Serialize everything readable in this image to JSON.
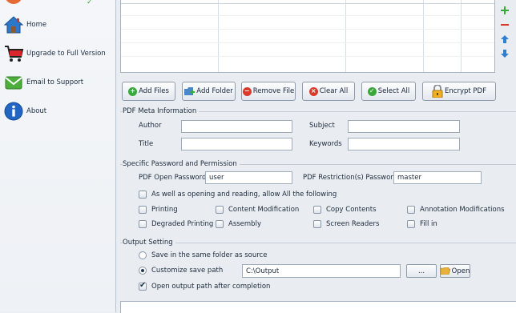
{
  "sidebar": {
    "items": [
      {
        "label": "Home",
        "icon": "home-icon"
      },
      {
        "label": "Upgrade to Full Version",
        "icon": "cart-icon"
      },
      {
        "label": "Email to Support",
        "icon": "email-icon"
      },
      {
        "label": "About",
        "icon": "info-icon"
      }
    ]
  },
  "toolbar": {
    "add_files": "Add Files",
    "add_folder": "Add Folder",
    "remove_file": "Remove File",
    "clear_all": "Clear All",
    "select_all": "Select All",
    "encrypt_pdf": "Encrypt PDF"
  },
  "meta": {
    "legend": "PDF Meta Information",
    "author_label": "Author",
    "author_value": "",
    "subject_label": "Subject",
    "subject_value": "",
    "title_label": "Title",
    "title_value": "",
    "keywords_label": "Keywords",
    "keywords_value": ""
  },
  "security": {
    "legend": "Specific Password and Permission",
    "open_password_label": "PDF Open Password",
    "open_password_value": "user",
    "restriction_password_label": "PDF Restriction(s) Password",
    "restriction_password_value": "master",
    "allow_all_label": "As well as opening and reading, allow All the following",
    "permissions": [
      {
        "label": "Printing",
        "checked": false
      },
      {
        "label": "Content Modification",
        "checked": false
      },
      {
        "label": "Copy Contents",
        "checked": false
      },
      {
        "label": "Annotation Modifications",
        "checked": false
      },
      {
        "label": "Degraded Printing",
        "checked": false
      },
      {
        "label": "Assembly",
        "checked": false
      },
      {
        "label": "Screen Readers",
        "checked": false
      },
      {
        "label": "Fill in",
        "checked": false
      }
    ]
  },
  "output": {
    "legend": "Output Setting",
    "same_folder_label": "Save in the same folder as source",
    "custom_path_label": "Customize save path",
    "selected": "custom",
    "path_value": "C:\\Output",
    "browse_label": "...",
    "open_label": "Open",
    "open_after_label": "Open output path after completion",
    "open_after_checked": true
  },
  "colors": {
    "add_green": "#3aa83a",
    "remove_red": "#d93a2a",
    "arrow_blue": "#2f7fd0"
  }
}
